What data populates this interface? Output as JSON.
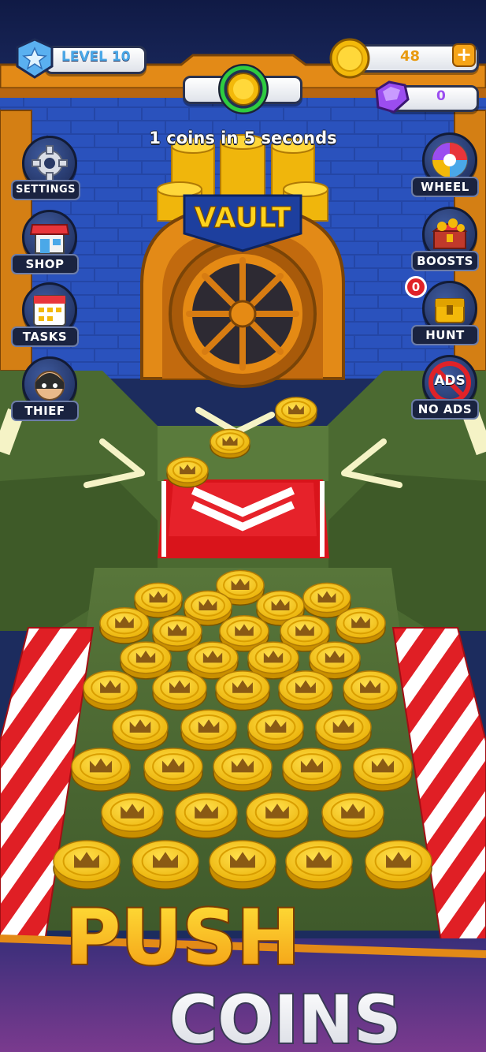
{
  "hud": {
    "level_label": "LEVEL 10",
    "coin_count": "48",
    "plus_label": "+",
    "gem_count": "0",
    "rate_text": "1 coins in 5 seconds"
  },
  "vault": {
    "title": "VAULT"
  },
  "left_menu": [
    {
      "label": "SETTINGS",
      "icon": "gear-icon"
    },
    {
      "label": "SHOP",
      "icon": "shop-icon"
    },
    {
      "label": "TASKS",
      "icon": "calendar-icon"
    },
    {
      "label": "THIEF",
      "icon": "thief-icon"
    }
  ],
  "right_menu": [
    {
      "label": "WHEEL",
      "icon": "wheel-icon"
    },
    {
      "label": "BOOSTS",
      "icon": "treasure-chest-icon"
    },
    {
      "label": "HUNT",
      "icon": "hunt-chest-icon",
      "badge": "0"
    },
    {
      "label": "NO ADS",
      "icon": "no-ads-icon",
      "inner": "ADS"
    }
  ],
  "banner": {
    "line1": "PUSH",
    "line2": "COINS"
  },
  "colors": {
    "wall": "#1f3a8c",
    "board": "#4f6b33",
    "gold": "#f7c61a",
    "frame": "#e38a17",
    "red": "#e02228"
  }
}
